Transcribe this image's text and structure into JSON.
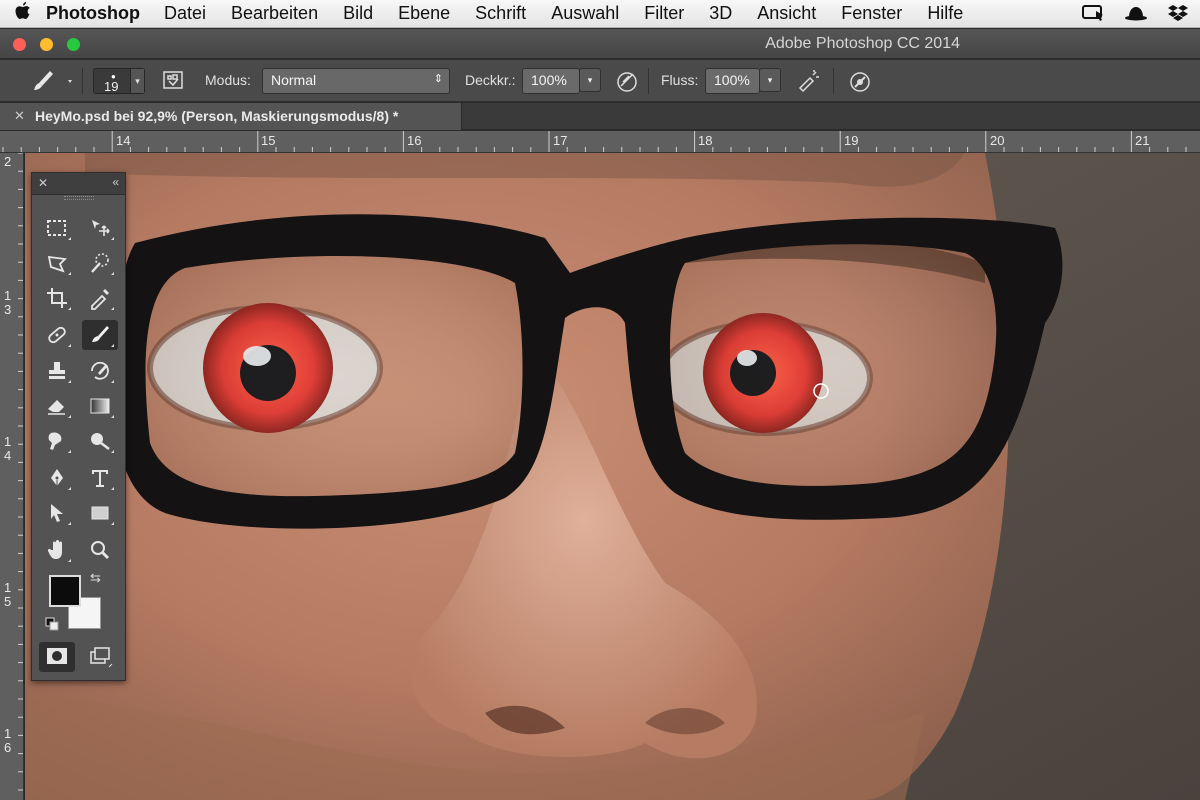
{
  "menubar": {
    "app": "Photoshop",
    "items": [
      "Datei",
      "Bearbeiten",
      "Bild",
      "Ebene",
      "Schrift",
      "Auswahl",
      "Filter",
      "3D",
      "Ansicht",
      "Fenster",
      "Hilfe"
    ],
    "status_icons": [
      "screen-sharing-icon",
      "bowler-hat-icon",
      "dropbox-icon"
    ]
  },
  "window": {
    "title": "Adobe Photoshop CC 2014"
  },
  "options": {
    "brush_size": "19",
    "mode_label": "Modus:",
    "mode_value": "Normal",
    "opacity_label": "Deckkr.:",
    "opacity_value": "100%",
    "flow_label": "Fluss:",
    "flow_value": "100%"
  },
  "document": {
    "tab_title": "HeyMo.psd bei 92,9% (Person, Maskierungsmodus/8) *"
  },
  "rulers": {
    "top": [
      "14",
      "15",
      "16",
      "17",
      "18",
      "19",
      "20",
      "21"
    ],
    "left": [
      "2",
      "1\n3",
      "1\n4",
      "1\n5",
      "1\n6"
    ]
  },
  "tools": {
    "items": [
      "rectangular-marquee-tool",
      "move-tool",
      "polygonal-lasso-tool",
      "quick-selection-tool",
      "crop-tool",
      "eyedropper-tool",
      "spot-healing-brush-tool",
      "brush-tool",
      "clone-stamp-tool",
      "history-brush-tool",
      "eraser-tool",
      "gradient-tool",
      "smudge-tool",
      "dodge-tool",
      "pen-tool",
      "type-tool",
      "path-selection-tool",
      "rectangle-tool",
      "hand-tool",
      "zoom-tool"
    ],
    "active": "brush-tool",
    "foreground_color": "#0c0c0c",
    "background_color": "#f5f5f5"
  },
  "colors": {
    "panel": "#535353",
    "iris": "#e0322a"
  }
}
